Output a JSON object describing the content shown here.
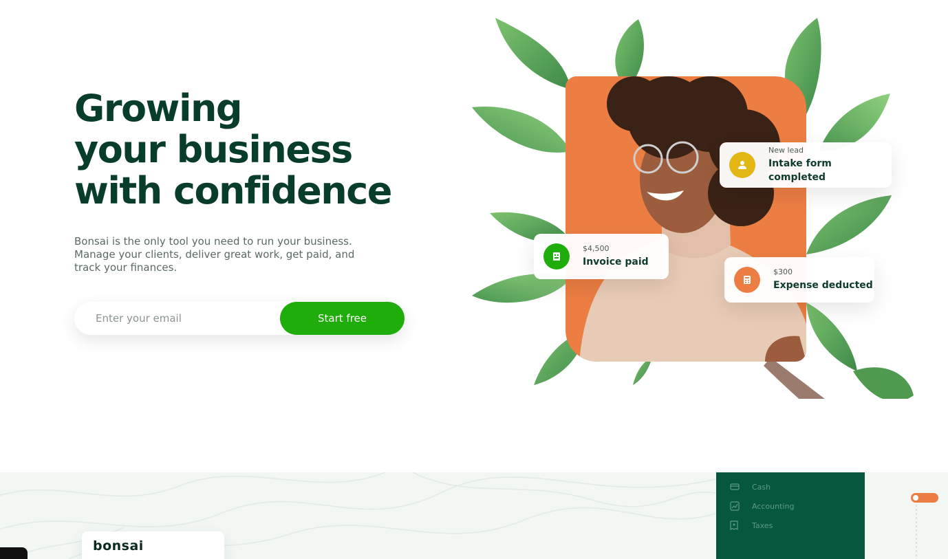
{
  "hero": {
    "title_line1": "Growing",
    "title_line2": "your business",
    "title_line3": "with confidence",
    "subtitle": "Bonsai is the only tool you need to run your business. Manage your clients, deliver great work, get paid, and track your finances."
  },
  "signup": {
    "email_placeholder": "Enter your email",
    "cta_label": "Start free"
  },
  "cards": {
    "lead": {
      "small": "New lead",
      "big": "Intake form completed",
      "color": "#e2b714"
    },
    "invoice": {
      "small": "$4,500",
      "big": "Invoice paid",
      "color": "#1fad0b"
    },
    "expense": {
      "small": "$300",
      "big": "Expense deducted",
      "color": "#ec7e43"
    }
  },
  "lower": {
    "logo": "bonsai",
    "sidebar": [
      {
        "label": "Cash",
        "icon": "card-icon"
      },
      {
        "label": "Accounting",
        "icon": "chart-icon"
      },
      {
        "label": "Taxes",
        "icon": "receipt-icon"
      }
    ]
  },
  "colors": {
    "brand_green": "#1fad0b",
    "dark_green": "#083d2c",
    "panel_green": "#05573f",
    "accent_orange": "#ec7e43"
  }
}
